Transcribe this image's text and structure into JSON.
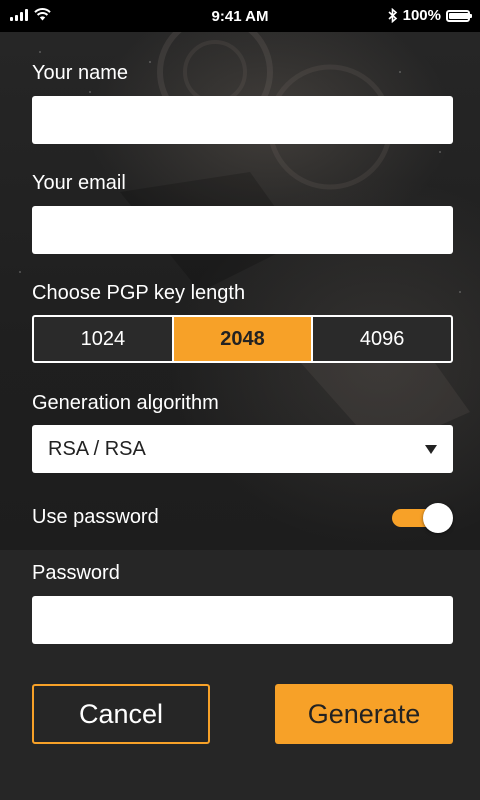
{
  "status_bar": {
    "time": "9:41 AM",
    "battery_text": "100%",
    "battery_level": 1.0,
    "icons": [
      "signal-icon",
      "wifi-icon",
      "bluetooth-icon",
      "battery-icon"
    ]
  },
  "form": {
    "name": {
      "label": "Your name",
      "value": "",
      "placeholder": ""
    },
    "email": {
      "label": "Your email",
      "value": "",
      "placeholder": ""
    },
    "key_length": {
      "label": "Choose PGP key length",
      "options": [
        "1024",
        "2048",
        "4096"
      ],
      "selected": "2048"
    },
    "algorithm": {
      "label": "Generation algorithm",
      "selected": "RSA / RSA",
      "icon": "chevron-down-icon"
    },
    "use_password": {
      "label": "Use password",
      "on": true
    },
    "password": {
      "label": "Password",
      "value": "",
      "placeholder": ""
    }
  },
  "actions": {
    "cancel_label": "Cancel",
    "generate_label": "Generate"
  },
  "colors": {
    "accent": "#f7a128",
    "background": "#232323",
    "panel": "#262626",
    "field": "#ffffff",
    "text_light": "#ffffff",
    "text_dark": "#222222"
  }
}
